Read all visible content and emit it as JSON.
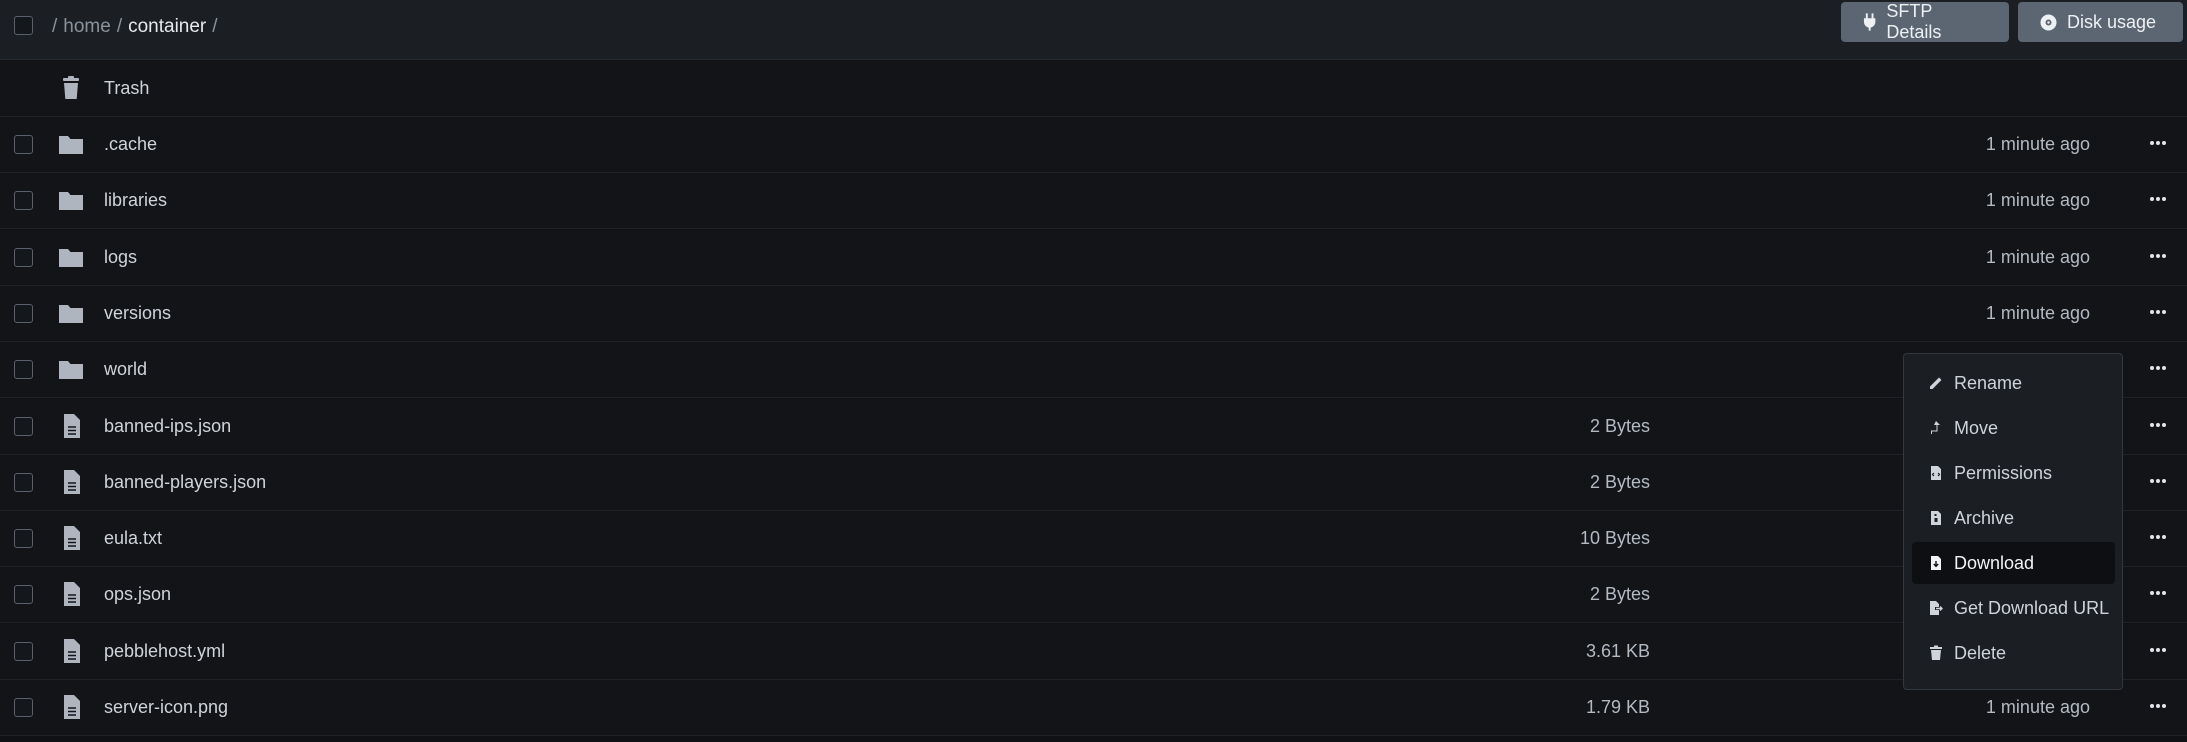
{
  "breadcrumb": {
    "sep1": "/",
    "home": "home",
    "sep2": "/",
    "current": "container",
    "sep3": "/"
  },
  "buttons": {
    "sftp": "SFTP Details",
    "disk": "Disk usage"
  },
  "trash": {
    "label": "Trash"
  },
  "rows": [
    {
      "name": ".cache",
      "size": "",
      "time": "1 minute ago",
      "icon": "folder-icon"
    },
    {
      "name": "libraries",
      "size": "",
      "time": "1 minute ago",
      "icon": "folder-icon"
    },
    {
      "name": "logs",
      "size": "",
      "time": "1 minute ago",
      "icon": "folder-icon"
    },
    {
      "name": "versions",
      "size": "",
      "time": "1 minute ago",
      "icon": "folder-icon"
    },
    {
      "name": "world",
      "size": "",
      "time": "",
      "icon": "folder-icon"
    },
    {
      "name": "banned-ips.json",
      "size": "2 Bytes",
      "time": "",
      "icon": "file-icon"
    },
    {
      "name": "banned-players.json",
      "size": "2 Bytes",
      "time": "",
      "icon": "file-icon"
    },
    {
      "name": "eula.txt",
      "size": "10 Bytes",
      "time": "",
      "icon": "file-icon"
    },
    {
      "name": "ops.json",
      "size": "2 Bytes",
      "time": "",
      "icon": "file-icon"
    },
    {
      "name": "pebblehost.yml",
      "size": "3.61 KB",
      "time": "",
      "icon": "file-icon"
    },
    {
      "name": "server-icon.png",
      "size": "1.79 KB",
      "time": "1 minute ago",
      "icon": "file-icon"
    }
  ],
  "menu": {
    "rename": "Rename",
    "move": "Move",
    "permissions": "Permissions",
    "archive": "Archive",
    "download": "Download",
    "get_url": "Get Download URL",
    "delete": "Delete"
  },
  "colors": {
    "background": "#0f1115",
    "topbar": "#1b1f24",
    "button": "#5b6672",
    "menu": "#1b1e22"
  }
}
